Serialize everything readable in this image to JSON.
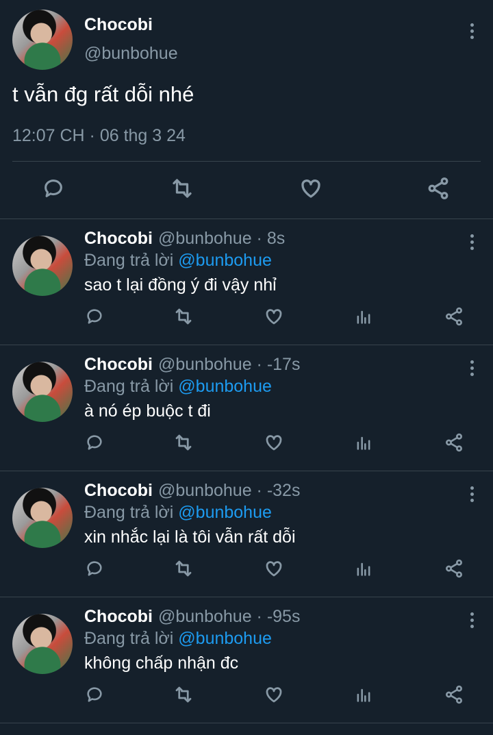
{
  "main_tweet": {
    "name": "Chocobi",
    "handle": "@bunbohue",
    "text": "t vẫn đg rất dỗi nhé",
    "timestamp": "12:07 CH · 06 thg 3 24",
    "actions": [
      "reply-icon",
      "retweet-icon",
      "like-icon",
      "share-icon"
    ]
  },
  "replies": [
    {
      "name": "Chocobi",
      "meta": "@bunbohue · 8s",
      "replying_prefix": "Đang trả lời ",
      "replying_mention": "@bunbohue",
      "text": "sao t lại đồng ý đi vậy nhỉ"
    },
    {
      "name": "Chocobi",
      "meta": "@bunbohue · -17s",
      "replying_prefix": "Đang trả lời ",
      "replying_mention": "@bunbohue",
      "text": "à nó ép buộc t đi"
    },
    {
      "name": "Chocobi",
      "meta": "@bunbohue · -32s",
      "replying_prefix": "Đang trả lời ",
      "replying_mention": "@bunbohue",
      "text": "xin nhắc lại là tôi vẫn rất dỗi"
    },
    {
      "name": "Chocobi",
      "meta": "@bunbohue · -95s",
      "replying_prefix": "Đang trả lời ",
      "replying_mention": "@bunbohue",
      "text": "không chấp nhận đc"
    }
  ],
  "reply_actions": [
    "reply-icon",
    "retweet-icon",
    "like-icon",
    "analytics-icon",
    "share-icon"
  ],
  "colors": {
    "background": "#15202b",
    "secondary_text": "#8899a6",
    "mention": "#1d9bf0",
    "divider": "#38444d"
  }
}
